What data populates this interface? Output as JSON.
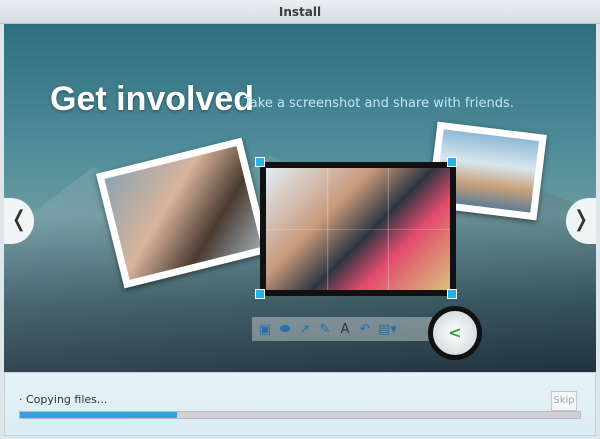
{
  "window": {
    "title": "Install"
  },
  "slide": {
    "heading": "Get involved",
    "subheading": "Take a screenshot and share with friends.",
    "toolbar_icons": [
      "rectangle-icon",
      "ellipse-icon",
      "arrow-icon",
      "pen-icon",
      "text-icon",
      "undo-icon",
      "save-icon",
      "share-icon"
    ],
    "prev_label": "❬",
    "next_label": "❭"
  },
  "progress": {
    "status": "Copying files...",
    "percent": 28,
    "skip_label": "Skip",
    "accent": "#3b9ee0"
  }
}
